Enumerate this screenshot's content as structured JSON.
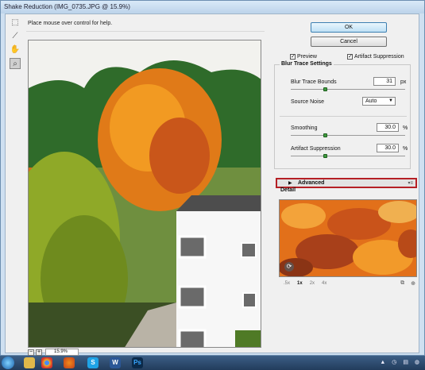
{
  "window": {
    "title": "Shake Reduction (IMG_0735.JPG @ 15.9%)"
  },
  "help_text": "Place mouse over control for help.",
  "tools": [
    "marquee-icon",
    "ruler-icon",
    "hand-icon",
    "zoom-icon"
  ],
  "zoom": {
    "value": "15.9%",
    "minus": "−",
    "plus": "+"
  },
  "buttons": {
    "ok": "OK",
    "cancel": "Cancel"
  },
  "options": {
    "preview": {
      "label": "Preview",
      "checked": true
    },
    "artifact_suppression": {
      "label": "Artifact Suppression",
      "checked": true
    }
  },
  "blur_trace": {
    "title": "Blur Trace Settings",
    "bounds": {
      "label": "Blur Trace Bounds",
      "value": "31",
      "unit": "px",
      "level": 0.3
    },
    "source_noise": {
      "label": "Source Noise",
      "value": "Auto"
    },
    "smoothing": {
      "label": "Smoothing",
      "value": "30.0",
      "unit": "%",
      "level": 0.3
    },
    "artifact": {
      "label": "Artifact Suppression",
      "value": "30.0",
      "unit": "%",
      "level": 0.3
    }
  },
  "advanced": {
    "label": "Advanced"
  },
  "detail": {
    "title": "Detail",
    "zoom_levels": [
      ".5x",
      "1x",
      "2x",
      "4x"
    ],
    "current_zoom": "1x"
  },
  "taskbar": {
    "apps": [
      "folder",
      "chrome",
      "firefox",
      "skype",
      "word",
      "photoshop"
    ],
    "labels": {
      "skype": "S",
      "word": "W",
      "photoshop": "Ps"
    }
  }
}
